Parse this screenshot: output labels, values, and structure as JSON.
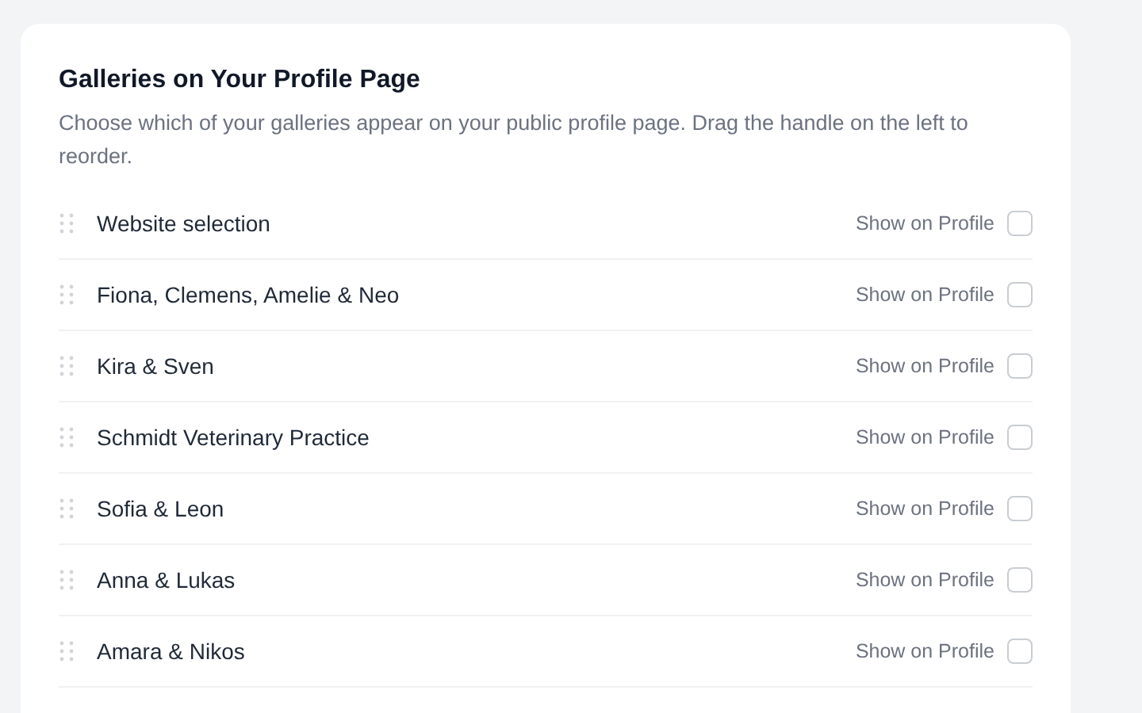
{
  "section": {
    "title": "Galleries on Your Profile Page",
    "description": "Choose which of your galleries appear on your public profile page. Drag the handle on the left to reorder."
  },
  "galleries": [
    {
      "name": "Website selection",
      "toggle_label": "Show on Profile",
      "checked": false
    },
    {
      "name": "Fiona, Clemens, Amelie & Neo",
      "toggle_label": "Show on Profile",
      "checked": false
    },
    {
      "name": "Kira & Sven",
      "toggle_label": "Show on Profile",
      "checked": false
    },
    {
      "name": "Schmidt Veterinary Practice",
      "toggle_label": "Show on Profile",
      "checked": false
    },
    {
      "name": "Sofia & Leon",
      "toggle_label": "Show on Profile",
      "checked": false
    },
    {
      "name": "Anna & Lukas",
      "toggle_label": "Show on Profile",
      "checked": false
    },
    {
      "name": "Amara & Nikos",
      "toggle_label": "Show on Profile",
      "checked": false
    }
  ]
}
